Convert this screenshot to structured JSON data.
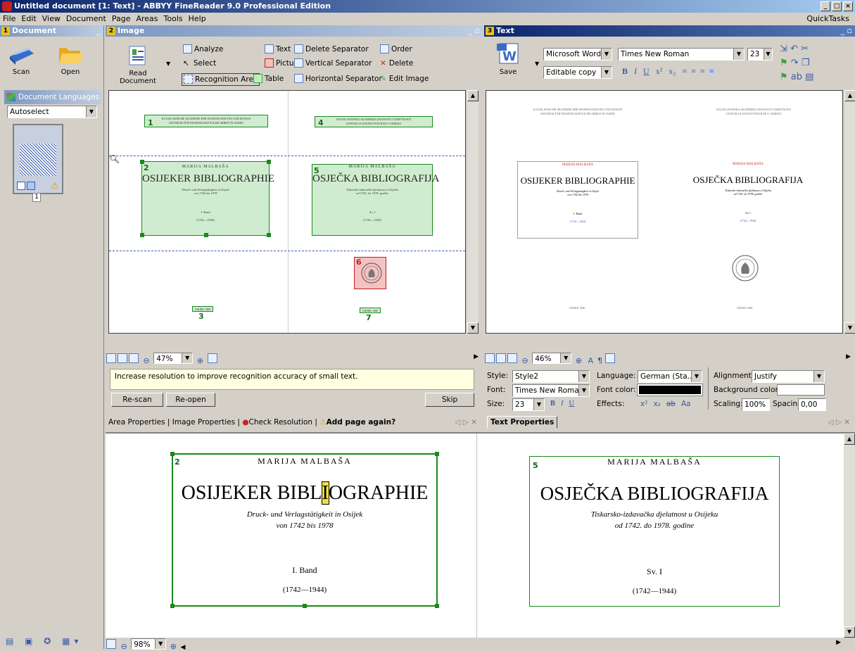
{
  "window": {
    "title": "Untitled document [1: Text] - ABBYY FineReader 9.0 Professional Edition",
    "controls": [
      "_",
      "□",
      "×"
    ]
  },
  "menu": {
    "items": [
      "File",
      "Edit",
      "View",
      "Document",
      "Page",
      "Areas",
      "Tools",
      "Help"
    ],
    "quicktasks": "QuickTasks"
  },
  "document_panel": {
    "number": "1",
    "title": "Document",
    "scan": "Scan",
    "open": "Open",
    "languages_label": "Document Languages",
    "language_value": "Autoselect",
    "page_number": "1"
  },
  "image_panel": {
    "number": "2",
    "title": "Image",
    "read_document": "Read Document",
    "tools": {
      "analyze": "Analyze",
      "select": "Select",
      "recognition_area": "Recognition Area",
      "text": "Text",
      "picture": "Picture",
      "table": "Table",
      "delete_separator": "Delete Separator",
      "vertical_separator": "Vertical Separator",
      "horizontal_separator": "Horizontal Separator",
      "order": "Order",
      "delete": "Delete",
      "edit_image": "Edit Image"
    },
    "zoom": "47%",
    "area_numbers": [
      "1",
      "2",
      "3",
      "4",
      "5",
      "6",
      "7"
    ],
    "left_page": {
      "header1": "JUGOSLAWISCHE AKADEMIE DER WISSENSCHAFTEN UND KÜNSTE",
      "header2": "ZENTRUM FÜR WISSENSCHAFTLICHE ARBEIT IN OSIJEK",
      "author": "MARIJA MALBAŠA",
      "title": "OSIJEKER BIBLIOGRAPHIE",
      "sub1": "Druck- und Verlagstätigkeit in Osijek",
      "sub2": "von 1742 bis 1978",
      "vol": "I. Band",
      "years": "(1742—1944)",
      "footer": "OSIJEK 1980"
    },
    "right_page": {
      "header1": "JUGOSLAVENSKA AKADEMIJA ZNANOSTI I UMJETNOSTI",
      "header2": "CENTAR ZA ZNANSTVENI RAD U OSIJEKU",
      "author": "MARIJA MALBAŠA",
      "title": "OSJEČKA BIBLIOGRAFIJA",
      "sub1": "Tiskarsko-izdavačka djelatnost u Osijeku",
      "sub2": "od 1742. do 1978. godine",
      "vol": "Sv. I",
      "years": "(1742—1944)",
      "footer": "OSIJEK 1980"
    }
  },
  "text_panel": {
    "number": "3",
    "title": "Text",
    "save": "Save",
    "format": "Microsoft Word D",
    "copy_mode": "Editable copy",
    "font": "Times New Roman",
    "size": "23",
    "fmt_buttons": [
      "B",
      "I",
      "U",
      "x²",
      "x₂"
    ],
    "zoom": "46%",
    "left": {
      "header1": "JUGOSLAWISCHE AKADEMIE DER WISSENSCHAFTEN UND KÜNSTE",
      "header2": "ZENTRUM FÜR WISSENSCHAFTLICHE ARBEIT IN OSIJEK",
      "author": "MARIJA MALBAŠA",
      "title": "OSIJEKER BIBLIOGRAPHIE",
      "sub1": "Druck- und Verlagstätigkeit in Osijek",
      "sub2": "von 1742 bis 1978",
      "vol": "I. Band",
      "years": "(1742—1944)",
      "footer": "OSIJEK 1980"
    },
    "right": {
      "header1": "JUGOSLAVENSKA AKADEMIJA ZNANOSTI I UMJETNOSTI",
      "header2": "CENTAR ZA ZNANSTVENI RAD U OSIJEKU",
      "author": "MARIJA MALBAŠA",
      "title": "OSJEČKA BIBLIOGRAFIJA",
      "sub1": "Tiskarsko-izdavačka djelatnost u Osijeku",
      "sub2": "od 1742. do 1978. godine",
      "vol": "Sv. I",
      "years": "(1742—1944)",
      "footer": "OSIJEK 1980"
    }
  },
  "warning": {
    "message": "Increase resolution to improve recognition accuracy of small text.",
    "rescan": "Re-scan",
    "reopen": "Re-open",
    "skip": "Skip"
  },
  "image_tabs": {
    "area_properties": "Area Properties",
    "image_properties": "Image Properties",
    "check_resolution": "Check Resolution",
    "add_page_again": "Add page again?"
  },
  "text_properties": {
    "tab": "Text Properties",
    "style_label": "Style:",
    "style_value": "Style2",
    "font_label": "Font:",
    "font_value": "Times New Roman",
    "size_label": "Size:",
    "size_value": "23",
    "language_label": "Language:",
    "language_value": "German (Sta...",
    "font_color_label": "Font color:",
    "effects_label": "Effects:",
    "effects": [
      "x²",
      "x₂",
      "ab",
      "Aa"
    ],
    "alignment_label": "Alignment:",
    "alignment_value": "Justify",
    "bgcolor_label": "Background color:",
    "scaling_label": "Scaling:",
    "scaling_value": "100%",
    "spacing_label": "Spacing:",
    "spacing_value": "0,00"
  },
  "zoom_pane": {
    "zoom": "98%",
    "left": {
      "num": "2",
      "author": "MARIJA MALBAŠA",
      "title_a": "OSIJEKER BIBL",
      "title_b": "I",
      "title_c": "OGRAPHIE",
      "sub1": "Druck- und Verlagstätigkeit in Osijek",
      "sub2": "von 1742 bis 1978",
      "vol": "I. Band",
      "years": "(1742—1944)"
    },
    "right": {
      "num": "5",
      "author": "MARIJA MALBAŠA",
      "title": "OSJEČKA BIBLIOGRAFIJA",
      "sub1": "Tiskarsko-izdavačka djelatnost u Osijeku",
      "sub2": "od 1742. do 1978. godine",
      "vol": "Sv. I",
      "years": "(1742—1944)"
    }
  },
  "colors": {
    "area_green": "#1a8a1a",
    "picture_red": "#c02020",
    "active_header": "#0a246a",
    "warning_bg": "#ffffe1"
  }
}
